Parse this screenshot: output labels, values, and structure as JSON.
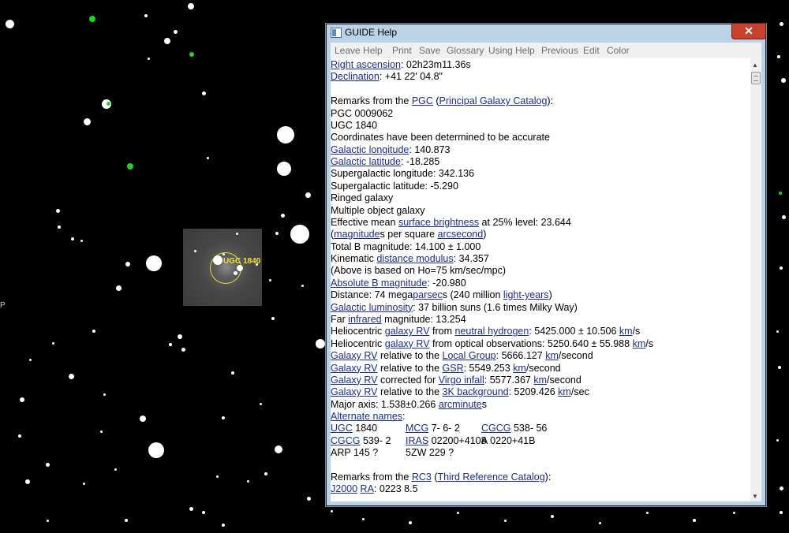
{
  "window": {
    "title": "GUIDE Help",
    "close_glyph": "✕",
    "menu": [
      "Leave Help",
      "Print",
      "Save",
      "Glossary",
      "Using Help",
      "Previous",
      "Edit",
      "Color"
    ]
  },
  "chart_label": "UGC 1840",
  "edge_text": "P",
  "content": {
    "lines": [
      [
        {
          "t": "Right ascension",
          "l": true
        },
        {
          "t": ": 02h23m11.36s"
        }
      ],
      [
        {
          "t": "Declination",
          "l": true
        },
        {
          "t": ": +41 22' 04.8\""
        }
      ],
      [],
      [
        {
          "t": "Remarks from the "
        },
        {
          "t": "PGC",
          "l": true
        },
        {
          "t": " ("
        },
        {
          "t": "Principal Galaxy Catalog",
          "l": true
        },
        {
          "t": "):"
        }
      ],
      [
        {
          "t": "PGC 0009062"
        }
      ],
      [
        {
          "t": "UGC     1840"
        }
      ],
      [
        {
          "t": "Coordinates have been determined to be accurate"
        }
      ],
      [
        {
          "t": "Galactic longitude",
          "l": true
        },
        {
          "t": ": 140.873"
        }
      ],
      [
        {
          "t": "Galactic latitude",
          "l": true
        },
        {
          "t": ": -18.285"
        }
      ],
      [
        {
          "t": "Supergalactic longitude: 342.136"
        }
      ],
      [
        {
          "t": "Supergalactic latitude: -5.290"
        }
      ],
      [
        {
          "t": "Ringed galaxy"
        }
      ],
      [
        {
          "t": "Multiple object galaxy"
        }
      ],
      [
        {
          "t": "Effective mean "
        },
        {
          "t": "surface brightness",
          "l": true
        },
        {
          "t": " at 25% level: 23.644"
        }
      ],
      [
        {
          "t": " ("
        },
        {
          "t": "magnitude",
          "l": true
        },
        {
          "t": "s per square "
        },
        {
          "t": "arcsecond",
          "l": true
        },
        {
          "t": ")"
        }
      ],
      [
        {
          "t": "Total B magnitude: 14.100 ± 1.000"
        }
      ],
      [
        {
          "t": "Kinematic "
        },
        {
          "t": "distance modulus",
          "l": true
        },
        {
          "t": ": 34.357"
        }
      ],
      [
        {
          "t": "(Above is based on Ho=75 km/sec/mpc)"
        }
      ],
      [
        {
          "t": "Absolute B magnitude",
          "l": true
        },
        {
          "t": ": -20.980"
        }
      ],
      [
        {
          "t": "Distance: 74 mega"
        },
        {
          "t": "parsec",
          "l": true
        },
        {
          "t": "s (240 million "
        },
        {
          "t": "light-years",
          "l": true
        },
        {
          "t": ")"
        }
      ],
      [
        {
          "t": "Galactic luminosity",
          "l": true
        },
        {
          "t": ": 37 billion suns (1.6 times Milky Way)"
        }
      ],
      [
        {
          "t": "Far "
        },
        {
          "t": "infrared",
          "l": true
        },
        {
          "t": " magnitude: 13.254"
        }
      ],
      [
        {
          "t": "Heliocentric "
        },
        {
          "t": "galaxy RV",
          "l": true
        },
        {
          "t": " from "
        },
        {
          "t": "neutral hydrogen",
          "l": true
        },
        {
          "t": ": 5425.000 ± 10.506  "
        },
        {
          "t": "km",
          "l": true
        },
        {
          "t": "/s"
        }
      ],
      [
        {
          "t": "Heliocentric "
        },
        {
          "t": "galaxy RV",
          "l": true
        },
        {
          "t": " from optical observations: 5250.640 ± 55.988  "
        },
        {
          "t": "km",
          "l": true
        },
        {
          "t": "/s"
        }
      ],
      [
        {
          "t": "Galaxy RV",
          "l": true
        },
        {
          "t": " relative to the "
        },
        {
          "t": "Local Group",
          "l": true
        },
        {
          "t": ": 5666.127 "
        },
        {
          "t": "km",
          "l": true
        },
        {
          "t": "/second"
        }
      ],
      [
        {
          "t": "Galaxy RV",
          "l": true
        },
        {
          "t": " relative to the "
        },
        {
          "t": "GSR",
          "l": true
        },
        {
          "t": ": 5549.253 "
        },
        {
          "t": "km",
          "l": true
        },
        {
          "t": "/second"
        }
      ],
      [
        {
          "t": "Galaxy RV",
          "l": true
        },
        {
          "t": " corrected for "
        },
        {
          "t": "Virgo infall",
          "l": true
        },
        {
          "t": ": 5577.367 "
        },
        {
          "t": "km",
          "l": true
        },
        {
          "t": "/second"
        }
      ],
      [
        {
          "t": "Galaxy RV",
          "l": true
        },
        {
          "t": " relative to the "
        },
        {
          "t": "3K background",
          "l": true
        },
        {
          "t": ": 5209.426 "
        },
        {
          "t": "km",
          "l": true
        },
        {
          "t": "/sec"
        }
      ],
      [
        {
          "t": "Major axis: 1.538±0.266  "
        },
        {
          "t": "arcminute",
          "l": true
        },
        {
          "t": "s"
        }
      ],
      [
        {
          "t": "Alternate names",
          "l": true
        },
        {
          "t": ":"
        }
      ],
      [],
      [],
      [],
      [],
      [
        {
          "t": "Remarks from the "
        },
        {
          "t": "RC3",
          "l": true
        },
        {
          "t": " ("
        },
        {
          "t": "Third Reference Catalog",
          "l": true
        },
        {
          "t": "):"
        }
      ],
      [
        {
          "t": "J2000",
          "l": true
        },
        {
          "t": " "
        },
        {
          "t": "RA",
          "l": true
        },
        {
          "t": ": 0223 8.5"
        }
      ]
    ],
    "alt_names": [
      [
        {
          "t": "UGC",
          "l": true
        },
        {
          "t": " 1840"
        }
      ],
      [
        {
          "t": "MCG",
          "l": true
        },
        {
          "t": " 7- 6- 2"
        }
      ],
      [
        {
          "t": "CGCG",
          "l": true
        },
        {
          "t": " 538- 56"
        }
      ],
      [
        {
          "t": "CGCG",
          "l": true
        },
        {
          "t": " 539- 2"
        }
      ],
      [
        {
          "t": "IRAS",
          "l": true
        },
        {
          "t": " 02200+4108"
        }
      ],
      [
        {
          "t": "A 0220+41B"
        }
      ],
      [
        {
          "t": "ARP 145 ?"
        }
      ],
      [
        {
          "t": "5ZW 229 ?"
        }
      ]
    ]
  }
}
